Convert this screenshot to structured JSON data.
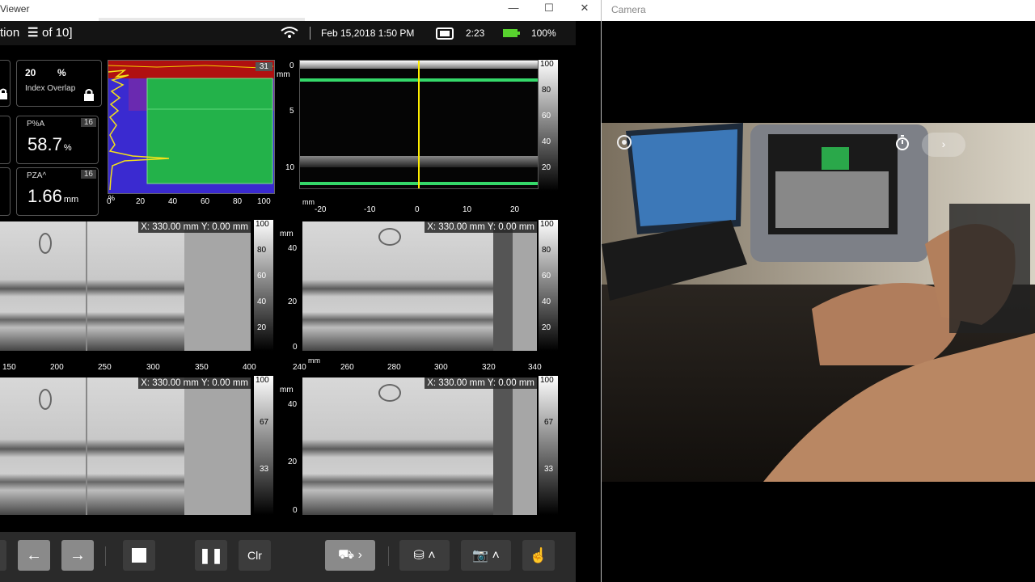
{
  "left_window": {
    "title": "Viewer",
    "controls": {
      "minimize": "—",
      "maximize": "☐",
      "close": "✕"
    }
  },
  "status": {
    "title_fragment": "tion",
    "page_indicator": "of 10]",
    "date_time": "Feb 15,2018  1:50 PM",
    "time_remaining": "2:23",
    "battery": "100%"
  },
  "readings": {
    "index_overlap": {
      "value": "20",
      "unit": "%",
      "label": "Index Overlap"
    },
    "pa": {
      "label": "P%A",
      "value": "58.7",
      "unit": "%",
      "tag": "16"
    },
    "pza": {
      "label": "PZA^",
      "value": "1.66",
      "unit": "mm",
      "tag": "16"
    }
  },
  "ascan": {
    "badge": "31",
    "x_ticks": [
      "0",
      "20",
      "40",
      "60",
      "80",
      "100"
    ],
    "percent_label": "%"
  },
  "bscan": {
    "unit": "mm",
    "y_ticks": [
      "0",
      "5",
      "10"
    ],
    "x_ticks": [
      "-20",
      "-10",
      "0",
      "10",
      "20"
    ],
    "scale_ticks": [
      "100",
      "80",
      "60",
      "40",
      "20"
    ]
  },
  "cscan1": {
    "cursor": "X: 330.00 mm Y: 0.00 mm",
    "scale_ticks": [
      "100",
      "80",
      "60",
      "40",
      "20"
    ],
    "x_ticks": [
      "150",
      "200",
      "250",
      "300",
      "350",
      "400"
    ]
  },
  "cscan2": {
    "cursor": "X: 330.00 mm Y: 0.00 mm",
    "unit": "mm",
    "y_ticks": [
      "40",
      "20",
      "0"
    ],
    "scale_ticks": [
      "100",
      "80",
      "60",
      "40",
      "20"
    ],
    "x_ticks": [
      "240",
      "260",
      "280",
      "300",
      "320",
      "340"
    ],
    "x_unit": "mm"
  },
  "cscan3": {
    "cursor": "X: 330.00 mm Y: 0.00 mm",
    "scale_ticks": [
      "100",
      "67",
      "33"
    ]
  },
  "cscan4": {
    "cursor": "X: 330.00 mm Y: 0.00 mm",
    "unit": "mm",
    "y_ticks": [
      "40",
      "20",
      "0"
    ],
    "scale_ticks": [
      "100",
      "67",
      "33"
    ]
  },
  "toolbar": {
    "clear_label": "Clr"
  },
  "right_window": {
    "title": "Camera"
  },
  "colors": {
    "accent_green": "#1fb34a",
    "cursor_yellow": "#ffee00",
    "battery_green": "#58d22e"
  }
}
